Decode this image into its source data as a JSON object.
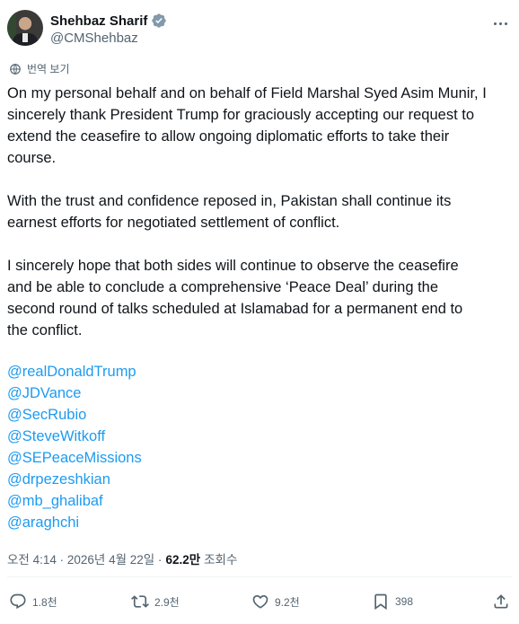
{
  "author": {
    "display_name": "Shehbaz Sharif",
    "handle": "@CMShehbaz",
    "verified_badge_color": "#829aab"
  },
  "translate_label": "번역 보기",
  "paragraphs": [
    "On my personal behalf and on behalf of Field Marshal Syed Asim Munir, I sincerely thank President Trump for graciously accepting our request to extend the ceasefire to allow ongoing diplomatic efforts to take their course.",
    "With the trust and confidence reposed in, Pakistan shall continue its earnest efforts for negotiated settlement of conflict.",
    "I sincerely hope that both sides will continue to observe the ceasefire and be able to conclude a comprehensive ‘Peace Deal’ during the second round of talks scheduled at Islamabad for a permanent end to the conflict."
  ],
  "paragraph_lines": [
    [
      "On my personal behalf and on behalf of Field Marshal Syed Asim Munir, I",
      "sincerely thank President Trump for graciously accepting our request to",
      "extend the ceasefire to allow ongoing diplomatic efforts to take their",
      "course."
    ],
    [
      "With the trust and confidence reposed in, Pakistan shall continue its",
      "earnest efforts for negotiated settlement of conflict."
    ],
    [
      "I sincerely hope that both sides will continue to observe the ceasefire",
      "and be able to conclude a comprehensive ‘Peace Deal’ during the",
      "second round of talks scheduled at Islamabad for a permanent end to",
      "the conflict."
    ]
  ],
  "mentions": [
    "@realDonaldTrump",
    "@JDVance",
    "@SecRubio",
    "@SteveWitkoff",
    "@SEPeaceMissions",
    "@drpezeshkian",
    "@mb_ghalibaf",
    "@araghchi"
  ],
  "meta": {
    "timestamp": "오전 4:14 · 2026년 4월 22일 ·",
    "views": "62.2만",
    "views_label": "조회수"
  },
  "actions": {
    "replies": "1.8천",
    "reposts": "2.9천",
    "likes": "9.2천",
    "bookmarks": "398"
  },
  "colors": {
    "link": "#1d9bf0",
    "secondary_text": "#536471",
    "primary_text": "#0f1419"
  }
}
